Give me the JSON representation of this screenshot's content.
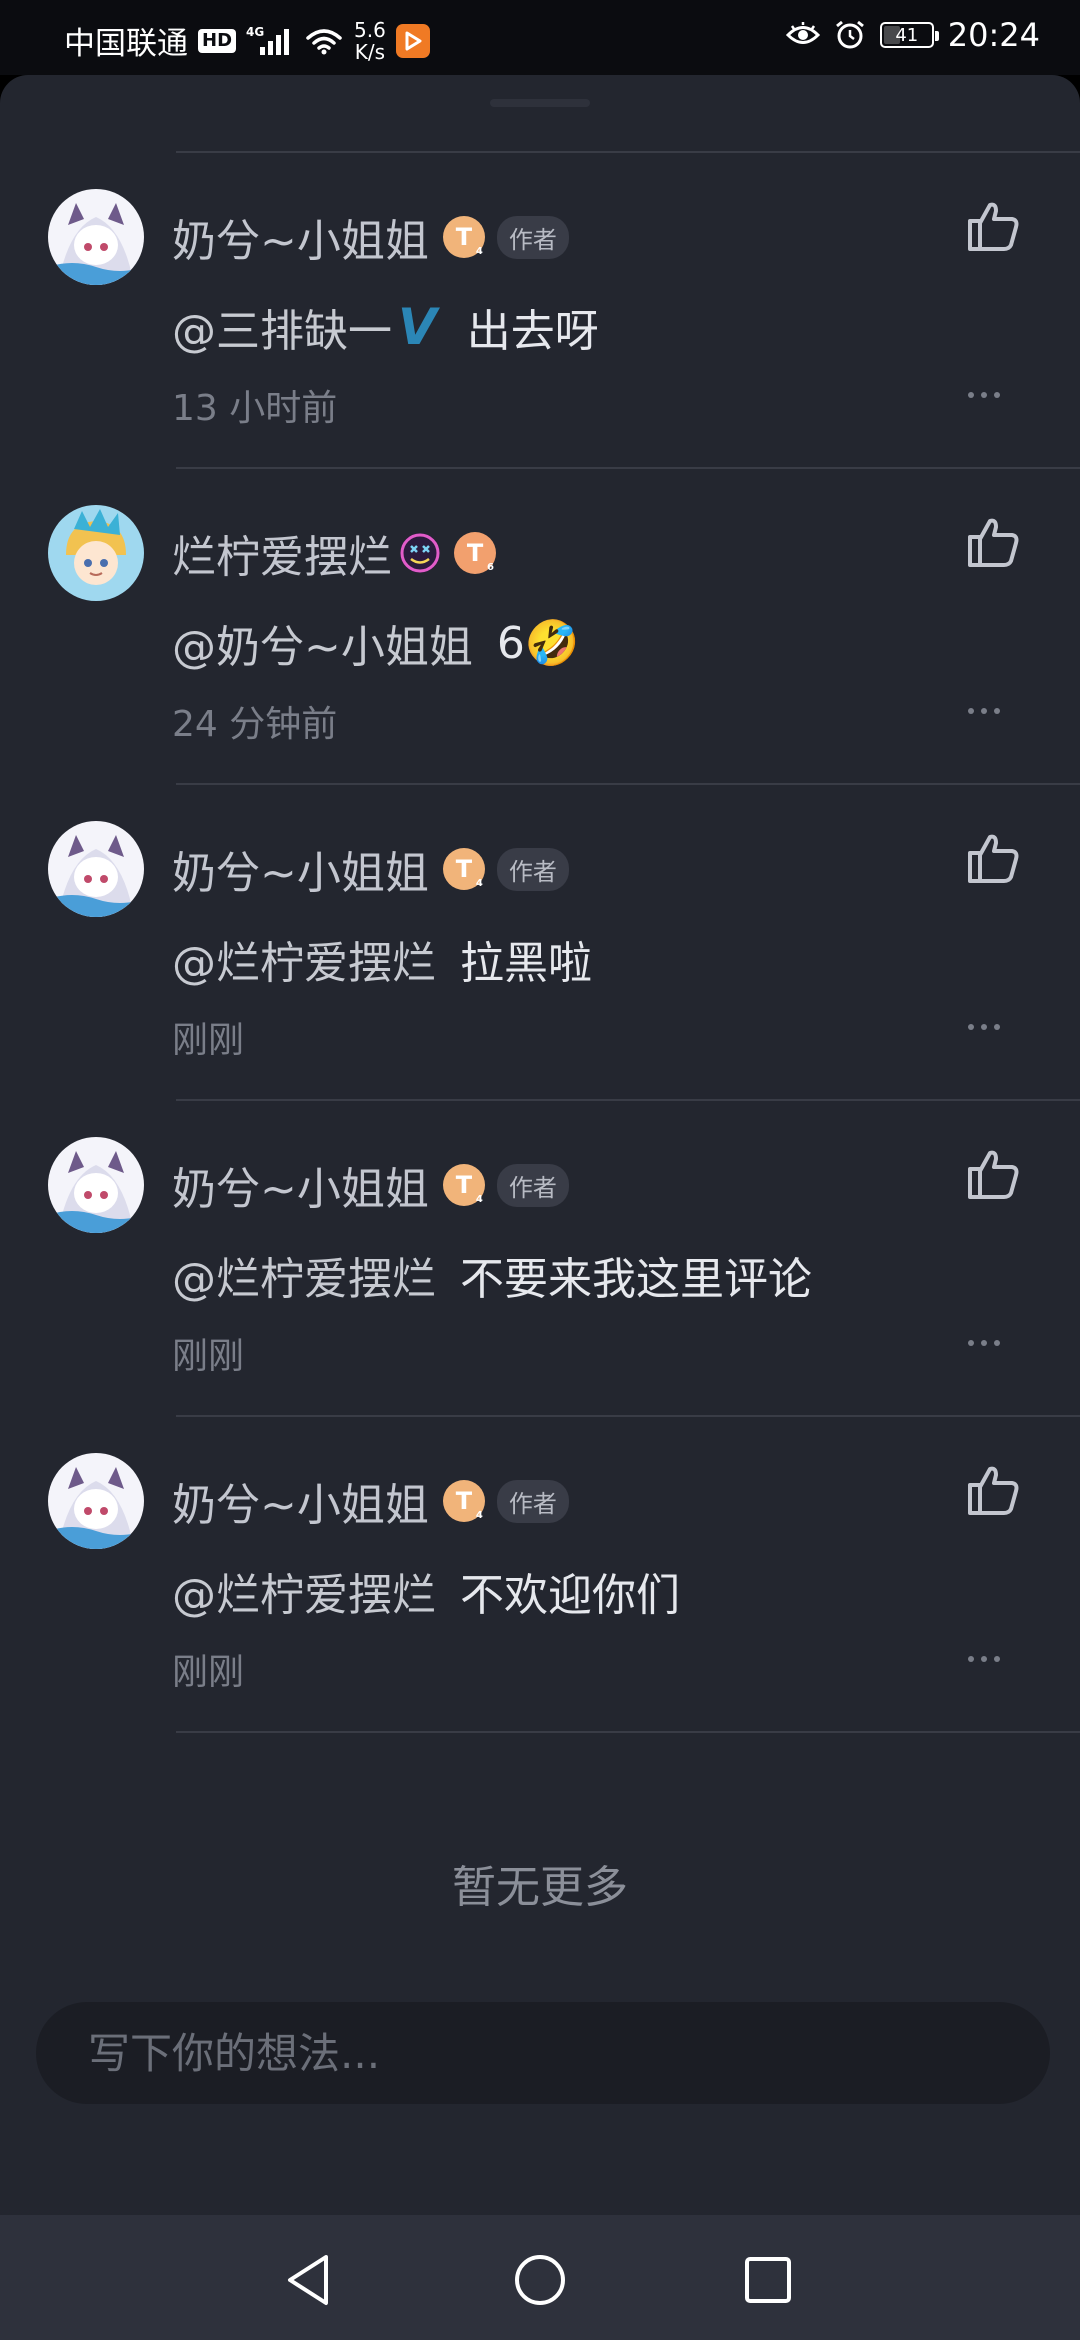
{
  "status_bar": {
    "carrier": "中国联通",
    "hd": "HD",
    "network": "4G",
    "speed_value": "5.6",
    "speed_unit": "K/s",
    "battery": "41",
    "battery_level_percent": 41,
    "time": "20:24",
    "icons": [
      "signal-icon",
      "wifi-icon",
      "app-notification-icon",
      "eye-comfort-icon",
      "alarm-icon",
      "battery-icon"
    ]
  },
  "comments": [
    {
      "username": "奶兮~小姐姐",
      "level": "T",
      "author_tag": "作者",
      "mention": "@三排缺一",
      "mention_badge": "V",
      "text": "出去呀",
      "time": "13 小时前"
    },
    {
      "username": "烂柠爱摆烂",
      "level": "T",
      "author_tag": "",
      "mention": "@奶兮~小姐姐",
      "mention_badge": "",
      "text": "6🤣",
      "time": "24 分钟前"
    },
    {
      "username": "奶兮~小姐姐",
      "level": "T",
      "author_tag": "作者",
      "mention": "@烂柠爱摆烂",
      "mention_badge": "",
      "text": "拉黑啦",
      "time": "刚刚"
    },
    {
      "username": "奶兮~小姐姐",
      "level": "T",
      "author_tag": "作者",
      "mention": "@烂柠爱摆烂",
      "mention_badge": "",
      "text": "不要来我这里评论",
      "time": "刚刚"
    },
    {
      "username": "奶兮~小姐姐",
      "level": "T",
      "author_tag": "作者",
      "mention": "@烂柠爱摆烂",
      "mention_badge": "",
      "text": "不欢迎你们",
      "time": "刚刚"
    }
  ],
  "no_more_text": "暂无更多",
  "input": {
    "placeholder": "写下你的想法...",
    "value": ""
  },
  "navbar": {
    "icons": [
      "back-icon",
      "home-icon",
      "recents-icon"
    ]
  },
  "colors": {
    "sheet_bg": "#23262f",
    "level_badge": "#f1b47a",
    "vip_badge": "#2b86b6",
    "status_bar_bg": "#0b0c10",
    "nav_bar_bg": "#2e313c"
  }
}
